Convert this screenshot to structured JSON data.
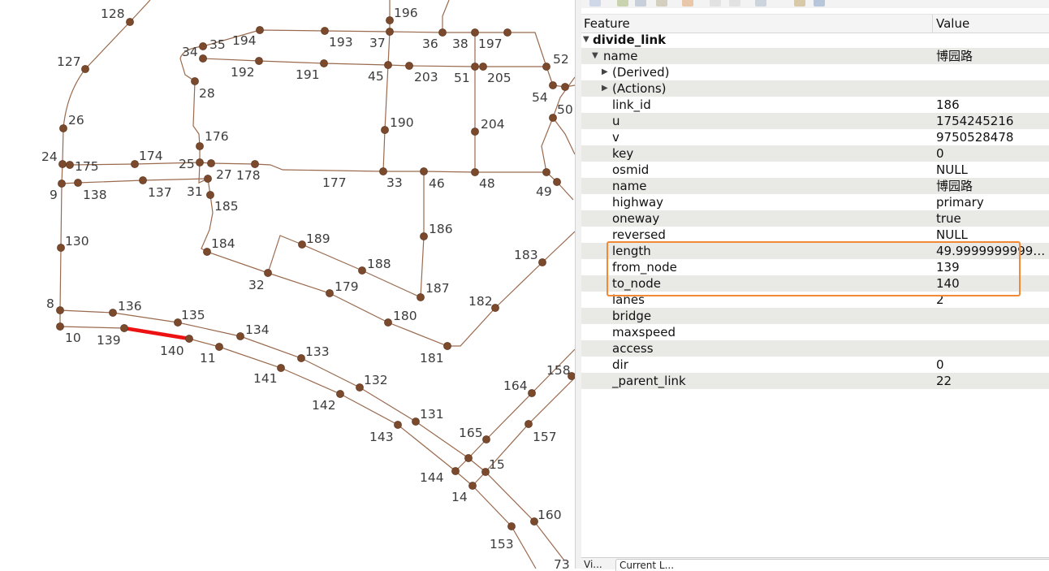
{
  "map": {
    "labels": [
      "128",
      "196",
      "194",
      "193",
      "37",
      "36",
      "38",
      "197",
      "35",
      "34",
      "192",
      "191",
      "45",
      "203",
      "51",
      "205",
      "52",
      "127",
      "28",
      "54",
      "50",
      "190",
      "204",
      "26",
      "176",
      "24",
      "175",
      "174",
      "25",
      "27",
      "178",
      "177",
      "33",
      "46",
      "48",
      "49",
      "9",
      "138",
      "137",
      "31",
      "185",
      "186",
      "130",
      "184",
      "189",
      "188",
      "32",
      "179",
      "187",
      "183",
      "8",
      "136",
      "135",
      "134",
      "182",
      "180",
      "10",
      "139",
      "140",
      "11",
      "133",
      "181",
      "141",
      "132",
      "164",
      "158",
      "142",
      "131",
      "143",
      "165",
      "157",
      "15",
      "144",
      "14",
      "160",
      "153",
      "73"
    ]
  },
  "panel": {
    "header": {
      "feature": "Feature",
      "value": "Value"
    },
    "rows": [
      {
        "feature": "divide_link",
        "value": ""
      },
      {
        "feature": "name",
        "value": "博园路"
      },
      {
        "feature": "(Derived)",
        "value": ""
      },
      {
        "feature": "(Actions)",
        "value": ""
      },
      {
        "feature": "link_id",
        "value": "186"
      },
      {
        "feature": "u",
        "value": "1754245216"
      },
      {
        "feature": "v",
        "value": "9750528478"
      },
      {
        "feature": "key",
        "value": "0"
      },
      {
        "feature": "osmid",
        "value": "NULL"
      },
      {
        "feature": "name",
        "value": "博园路"
      },
      {
        "feature": "highway",
        "value": "primary"
      },
      {
        "feature": "oneway",
        "value": "true"
      },
      {
        "feature": "reversed",
        "value": "NULL"
      },
      {
        "feature": "length",
        "value": "49.99999999999394..."
      },
      {
        "feature": "from_node",
        "value": "139"
      },
      {
        "feature": "to_node",
        "value": "140"
      },
      {
        "feature": "lanes",
        "value": "2"
      },
      {
        "feature": "bridge",
        "value": ""
      },
      {
        "feature": "maxspeed",
        "value": ""
      },
      {
        "feature": "access",
        "value": ""
      },
      {
        "feature": "dir",
        "value": "0"
      },
      {
        "feature": "_parent_link",
        "value": "22"
      }
    ],
    "bottom": {
      "left_tab": "Vi...",
      "right_tab": "Current L..."
    }
  },
  "colors": {
    "road": "#9a6a4e",
    "node": "#7b4a2d",
    "selected": "#ee1111",
    "highlight_box": "#f08a36"
  }
}
